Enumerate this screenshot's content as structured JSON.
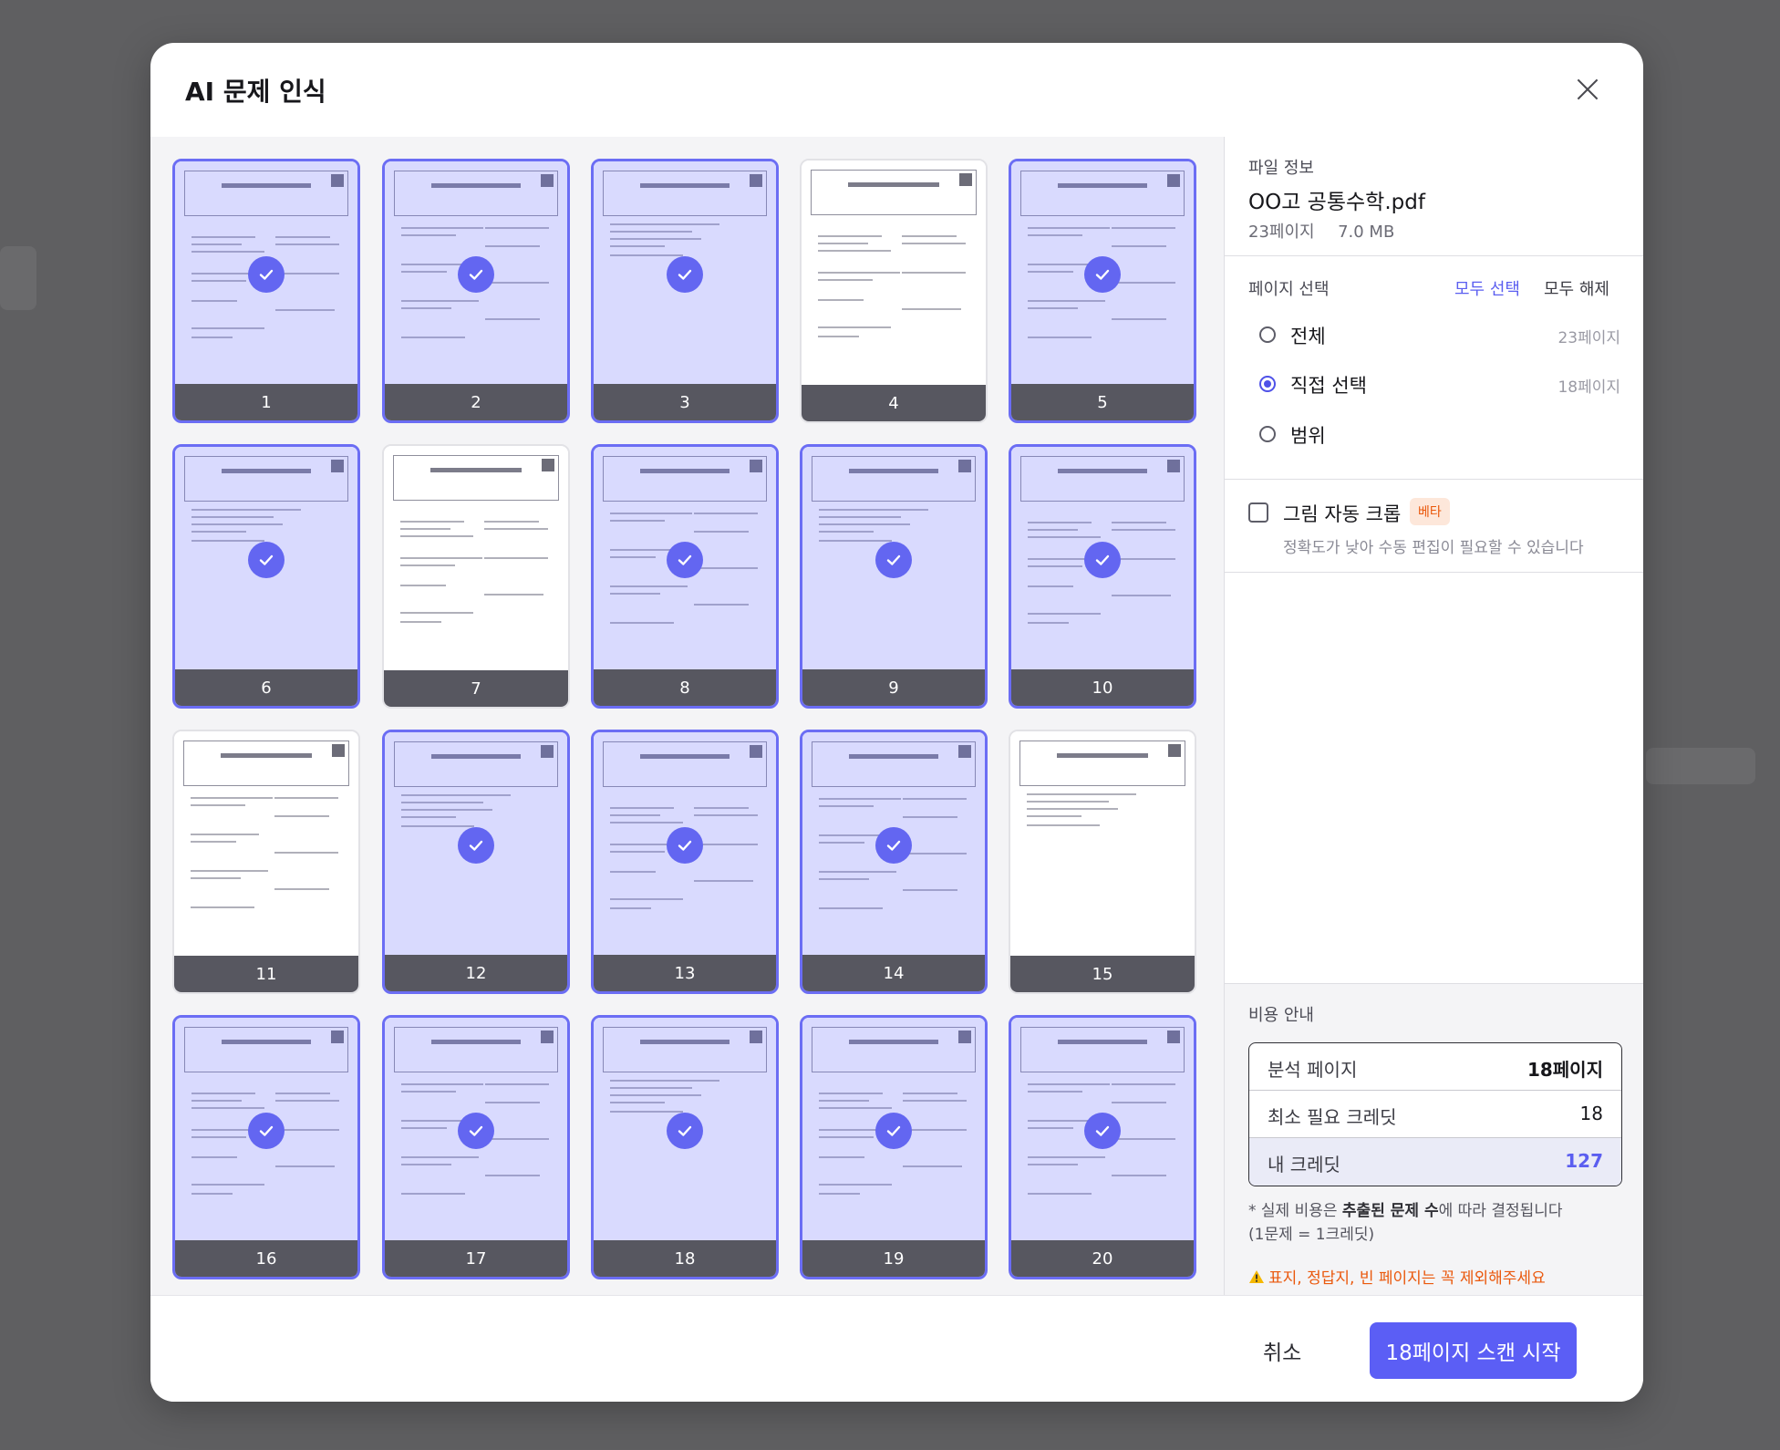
{
  "modal": {
    "title": "AI 문제 인식",
    "close_icon": "close-icon"
  },
  "pages": [
    {
      "number": "1",
      "selected": true
    },
    {
      "number": "2",
      "selected": true
    },
    {
      "number": "3",
      "selected": true
    },
    {
      "number": "4",
      "selected": false
    },
    {
      "number": "5",
      "selected": true
    },
    {
      "number": "6",
      "selected": true
    },
    {
      "number": "7",
      "selected": false
    },
    {
      "number": "8",
      "selected": true
    },
    {
      "number": "9",
      "selected": true
    },
    {
      "number": "10",
      "selected": true
    },
    {
      "number": "11",
      "selected": false
    },
    {
      "number": "12",
      "selected": true
    },
    {
      "number": "13",
      "selected": true
    },
    {
      "number": "14",
      "selected": true
    },
    {
      "number": "15",
      "selected": false
    },
    {
      "number": "16",
      "selected": true
    },
    {
      "number": "17",
      "selected": true
    },
    {
      "number": "18",
      "selected": true
    },
    {
      "number": "19",
      "selected": true
    },
    {
      "number": "20",
      "selected": true
    }
  ],
  "file_info": {
    "label": "파일 정보",
    "name": "OO고 공통수학.pdf",
    "pages": "23페이지",
    "size": "7.0 MB"
  },
  "page_select": {
    "label": "페이지 선택",
    "select_all": "모두 선택",
    "deselect_all": "모두 해제",
    "options": [
      {
        "label": "전체",
        "count": "23페이지",
        "checked": false
      },
      {
        "label": "직접 선택",
        "count": "18페이지",
        "checked": true
      },
      {
        "label": "범위",
        "count": "",
        "checked": false
      }
    ]
  },
  "auto_crop": {
    "label": "그림 자동 크롭",
    "badge": "베타",
    "description": "정확도가 낮아 수동 편집이 필요할 수 있습니다",
    "checked": false
  },
  "cost": {
    "label": "비용 안내",
    "rows": [
      {
        "key": "분석 페이지",
        "value": "18페이지"
      },
      {
        "key": "최소 필요 크레딧",
        "value": "18"
      },
      {
        "key": "내 크레딧",
        "value": "127"
      }
    ],
    "note_prefix": "* 실제 비용은 ",
    "note_bold": "추출된 문제 수",
    "note_suffix": "에 따라 결정됩니다",
    "note_line2": "(1문제 = 1크레딧)",
    "warning": "표지, 정답지, 빈 페이지는 꼭 제외해주세요"
  },
  "footer": {
    "cancel": "취소",
    "start": "18페이지 스캔 시작"
  },
  "colors": {
    "accent": "#5b5ef5",
    "warning": "#ea580c",
    "selected_overlay": "#787afa"
  }
}
